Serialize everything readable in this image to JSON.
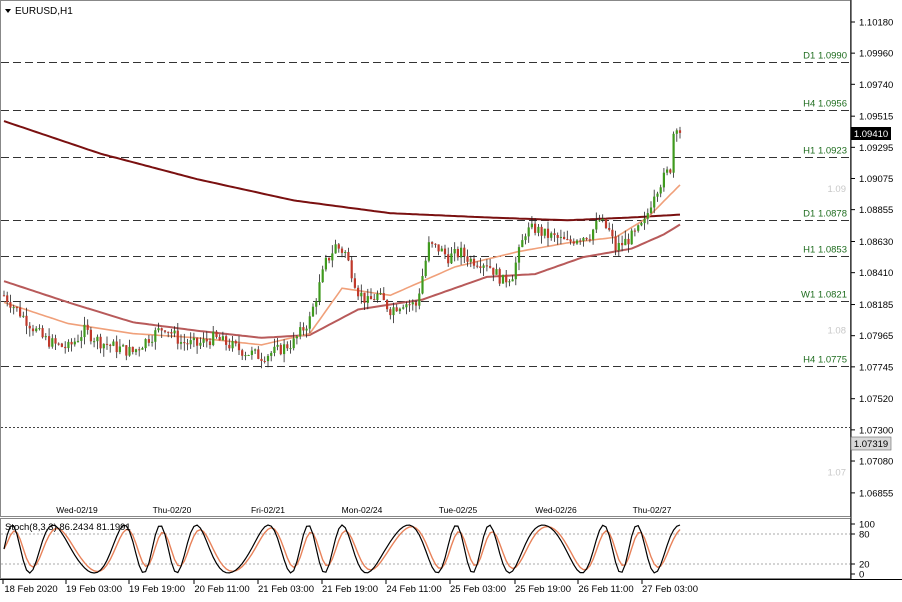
{
  "symbol": "EURUSD,H1",
  "price_box": "1.09410",
  "low_box": "1.07319",
  "stoch_label": "Stoch(8,3,3) 86.2434 81.1991",
  "colors": {
    "bull": "#3f9a1e",
    "bear": "#c0392b",
    "ma_slow": "#7a1010",
    "ma_mid": "#b85a5a",
    "ma_fast": "#f0a07a",
    "level": "#333333",
    "level_label": "#1f6d1f"
  },
  "chart_data": {
    "type": "candlestick",
    "ylim": [
      1.0672,
      1.103
    ],
    "y_ticks": [
      "1.10180",
      "1.09960",
      "1.09740",
      "1.09515",
      "1.09295",
      "1.09075",
      "1.08855",
      "1.08630",
      "1.08410",
      "1.08185",
      "1.07965",
      "1.07745",
      "1.07520",
      "1.07300",
      "1.07080",
      "1.06855"
    ],
    "levels": [
      {
        "label": "D1 1.0990",
        "value": 1.099
      },
      {
        "label": "H4 1.0956",
        "value": 1.0956
      },
      {
        "label": "H1 1.0923",
        "value": 1.0923
      },
      {
        "label": "D1 1.0878",
        "value": 1.0878
      },
      {
        "label": "H1 1.0853",
        "value": 1.0853
      },
      {
        "label": "W1 1.0821",
        "value": 1.0821
      },
      {
        "label": "H4 1.0775",
        "value": 1.0775
      }
    ],
    "dotted_levels": [
      1.07319
    ],
    "round_labels": [
      {
        "label": "1.09",
        "value": 1.09
      },
      {
        "label": "1.08",
        "value": 1.08
      },
      {
        "label": "1.07",
        "value": 1.07
      }
    ],
    "price_date_labels": [
      "Wed-02/19",
      "Thu-02/20",
      "Fri-02/21",
      "Mon-02/24",
      "Tue-02/25",
      "Wed-02/26",
      "Thu-02/27"
    ],
    "x_labels": [
      "18 Feb 2020",
      "19 Feb 03:00",
      "19 Feb 19:00",
      "20 Feb 11:00",
      "21 Feb 03:00",
      "21 Feb 19:00",
      "24 Feb 11:00",
      "25 Feb 03:00",
      "25 Feb 19:00",
      "26 Feb 11:00",
      "27 Feb 03:00"
    ],
    "close_path": [
      [
        0,
        1.0825
      ],
      [
        4,
        1.0815
      ],
      [
        8,
        1.0805
      ],
      [
        12,
        1.0795
      ],
      [
        16,
        1.079
      ],
      [
        20,
        1.0788
      ],
      [
        25,
        1.08
      ],
      [
        30,
        1.0792
      ],
      [
        35,
        1.0788
      ],
      [
        40,
        1.0785
      ],
      [
        45,
        1.0795
      ],
      [
        50,
        1.0803
      ],
      [
        55,
        1.0792
      ],
      [
        60,
        1.079
      ],
      [
        65,
        1.0795
      ],
      [
        70,
        1.079
      ],
      [
        75,
        1.0785
      ],
      [
        80,
        1.0782
      ],
      [
        85,
        1.0786
      ],
      [
        90,
        1.0792
      ],
      [
        95,
        1.0808
      ],
      [
        100,
        1.0848
      ],
      [
        103,
        1.086
      ],
      [
        106,
        1.0855
      ],
      [
        110,
        1.0828
      ],
      [
        113,
        1.082
      ],
      [
        116,
        1.0825
      ],
      [
        120,
        1.0815
      ],
      [
        124,
        1.082
      ],
      [
        128,
        1.0818
      ],
      [
        132,
        1.086
      ],
      [
        135,
        1.0858
      ],
      [
        138,
        1.0852
      ],
      [
        142,
        1.0855
      ],
      [
        145,
        1.085
      ],
      [
        150,
        1.0848
      ],
      [
        155,
        1.0835
      ],
      [
        158,
        1.084
      ],
      [
        162,
        1.087
      ],
      [
        165,
        1.0872
      ],
      [
        168,
        1.0868
      ],
      [
        172,
        1.0865
      ],
      [
        175,
        1.0862
      ],
      [
        178,
        1.0866
      ],
      [
        182,
        1.0868
      ],
      [
        185,
        1.0878
      ],
      [
        188,
        1.087
      ],
      [
        190,
        1.0858
      ],
      [
        193,
        1.0863
      ],
      [
        196,
        1.0868
      ],
      [
        199,
        1.0876
      ],
      [
        202,
        1.0898
      ],
      [
        205,
        1.0908
      ],
      [
        207,
        1.0915
      ],
      [
        208,
        1.094
      ],
      [
        209,
        1.0946
      ],
      [
        210,
        1.0941
      ]
    ],
    "ma_slow_path": [
      [
        0,
        1.0948
      ],
      [
        30,
        1.0925
      ],
      [
        60,
        1.0907
      ],
      [
        90,
        1.0892
      ],
      [
        120,
        1.0883
      ],
      [
        150,
        1.088
      ],
      [
        175,
        1.0878
      ],
      [
        195,
        1.088
      ],
      [
        210,
        1.0882
      ]
    ],
    "ma_mid_path": [
      [
        0,
        1.0835
      ],
      [
        20,
        1.082
      ],
      [
        40,
        1.0806
      ],
      [
        60,
        1.08
      ],
      [
        80,
        1.0795
      ],
      [
        95,
        1.0797
      ],
      [
        110,
        1.0815
      ],
      [
        130,
        1.0822
      ],
      [
        150,
        1.0838
      ],
      [
        165,
        1.084
      ],
      [
        180,
        1.0852
      ],
      [
        195,
        1.0858
      ],
      [
        205,
        1.0868
      ],
      [
        210,
        1.0875
      ]
    ],
    "ma_fast_path": [
      [
        0,
        1.082
      ],
      [
        20,
        1.0805
      ],
      [
        40,
        1.0798
      ],
      [
        60,
        1.0795
      ],
      [
        80,
        1.079
      ],
      [
        95,
        1.0798
      ],
      [
        105,
        1.083
      ],
      [
        120,
        1.0825
      ],
      [
        140,
        1.0845
      ],
      [
        160,
        1.0856
      ],
      [
        175,
        1.0862
      ],
      [
        190,
        1.0866
      ],
      [
        200,
        1.088
      ],
      [
        210,
        1.0903
      ]
    ],
    "stoch_ylim": [
      0,
      100
    ],
    "stoch_ticks": [
      "100",
      "80",
      "20",
      "0"
    ]
  }
}
